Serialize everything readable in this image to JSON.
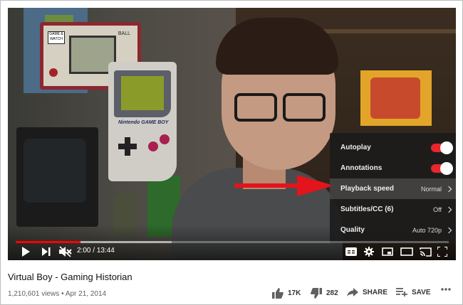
{
  "video": {
    "title": "Virtual Boy - Gaming Historian",
    "views": "1,210,601 views",
    "date_sep": "•",
    "date": "Apr 21, 2014",
    "progress_fraction": 0.149,
    "buffered_fraction": 0.36
  },
  "player": {
    "time_current": "2:00",
    "time_sep": "/",
    "time_total": "13:44",
    "prop_text": {
      "gw_brand": "GAME & WATCH",
      "gw_game": "BALL",
      "gb_brand": "Nintendo GAME BOY"
    }
  },
  "settings_menu": {
    "autoplay": {
      "label": "Autoplay",
      "on": true
    },
    "annotations": {
      "label": "Annotations",
      "on": true
    },
    "playback_speed": {
      "label": "Playback speed",
      "value": "Normal"
    },
    "subtitles": {
      "label": "Subtitles/CC (6)",
      "value": "Off"
    },
    "quality": {
      "label": "Quality",
      "value": "Auto 720p"
    }
  },
  "actions": {
    "likes": "17K",
    "dislikes": "282",
    "share": "SHARE",
    "save": "SAVE"
  },
  "colors": {
    "accent": "#ff0000",
    "toggle_on": "#e8262e",
    "annotation_arrow": "#e3141b"
  }
}
